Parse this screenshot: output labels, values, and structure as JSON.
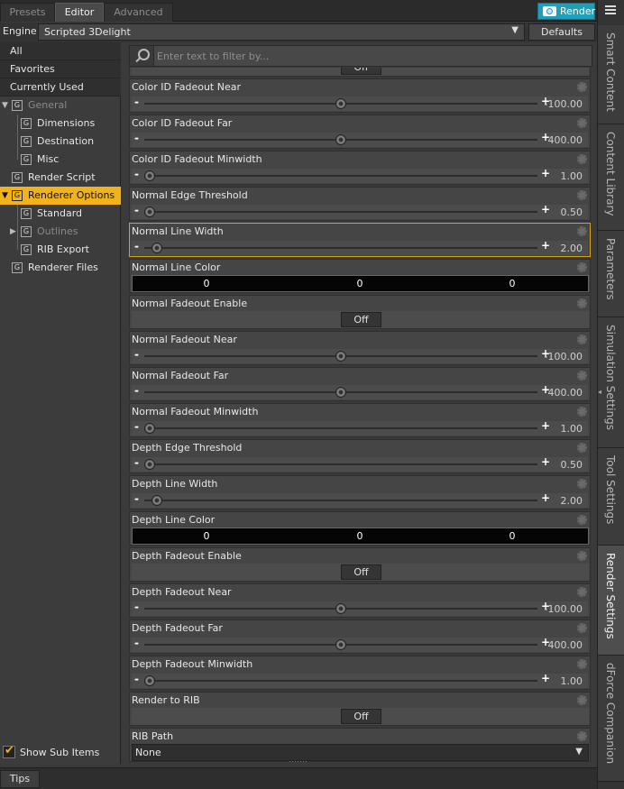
{
  "tabs": [
    {
      "label": "Presets",
      "active": false
    },
    {
      "label": "Editor",
      "active": true
    },
    {
      "label": "Advanced",
      "active": false
    }
  ],
  "render_button": "Render",
  "engine": {
    "label": "Engine :",
    "value": "Scripted 3Delight",
    "defaults_label": "Defaults"
  },
  "filter": {
    "placeholder": "Enter text to filter by..."
  },
  "tree": {
    "all": "All",
    "favorites": "Favorites",
    "currently_used": "Currently Used",
    "general": "General",
    "dimensions": "Dimensions",
    "destination": "Destination",
    "misc": "Misc",
    "render_script": "Render Script",
    "renderer_options": "Renderer Options",
    "standard": "Standard",
    "outlines": "Outlines",
    "rib_export": "RIB Export",
    "renderer_files": "Renderer Files",
    "group_glyph": "G"
  },
  "show_sub_items": {
    "label": "Show Sub Items",
    "checked": true
  },
  "partial_toggle": "Off",
  "properties": [
    {
      "name": "Color ID Fadeout Near",
      "type": "slider",
      "value": "-100.00",
      "pos": 0.5
    },
    {
      "name": "Color ID Fadeout Far",
      "type": "slider",
      "value": "400.00",
      "pos": 0.5
    },
    {
      "name": "Color ID Fadeout Minwidth",
      "type": "slider",
      "value": "1.00",
      "pos": 0.0
    },
    {
      "name": "Normal Edge Threshold",
      "type": "slider",
      "value": "0.50",
      "pos": 0.0
    },
    {
      "name": "Normal Line Width",
      "type": "slider",
      "value": "2.00",
      "pos": 0.02,
      "highlighted": true
    },
    {
      "name": "Normal Line Color",
      "type": "color",
      "rgb": [
        "0",
        "0",
        "0"
      ]
    },
    {
      "name": "Normal Fadeout Enable",
      "type": "toggle",
      "value": "Off"
    },
    {
      "name": "Normal Fadeout Near",
      "type": "slider",
      "value": "-100.00",
      "pos": 0.5
    },
    {
      "name": "Normal Fadeout Far",
      "type": "slider",
      "value": "400.00",
      "pos": 0.5
    },
    {
      "name": "Normal Fadeout Minwidth",
      "type": "slider",
      "value": "1.00",
      "pos": 0.0
    },
    {
      "name": "Depth Edge Threshold",
      "type": "slider",
      "value": "0.50",
      "pos": 0.0
    },
    {
      "name": "Depth Line Width",
      "type": "slider",
      "value": "2.00",
      "pos": 0.02
    },
    {
      "name": "Depth Line Color",
      "type": "color",
      "rgb": [
        "0",
        "0",
        "0"
      ]
    },
    {
      "name": "Depth Fadeout Enable",
      "type": "toggle",
      "value": "Off"
    },
    {
      "name": "Depth Fadeout Near",
      "type": "slider",
      "value": "-100.00",
      "pos": 0.5
    },
    {
      "name": "Depth Fadeout Far",
      "type": "slider",
      "value": "400.00",
      "pos": 0.5
    },
    {
      "name": "Depth Fadeout Minwidth",
      "type": "slider",
      "value": "1.00",
      "pos": 0.0
    },
    {
      "name": "Render to RIB",
      "type": "toggle",
      "value": "Off"
    },
    {
      "name": "RIB Path",
      "type": "dropdown",
      "value": "None"
    }
  ],
  "side_tabs": [
    {
      "label": "Smart Content",
      "active": false
    },
    {
      "label": "Content Library",
      "active": false
    },
    {
      "label": "Parameters",
      "active": false
    },
    {
      "label": "Simulation Settings",
      "active": false
    },
    {
      "label": "Tool Settings",
      "active": false
    },
    {
      "label": "Render Settings",
      "active": true
    },
    {
      "label": "dForce Companion",
      "active": false
    }
  ],
  "bottom": {
    "tips": "Tips"
  },
  "colors": {
    "accent": "#f2b21a",
    "render": "#1f9fb8"
  }
}
